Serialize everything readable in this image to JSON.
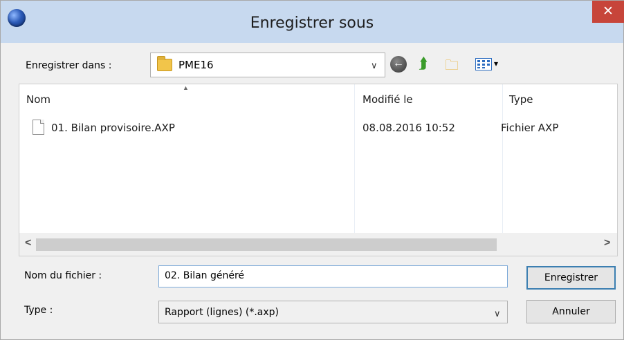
{
  "window": {
    "title": "Enregistrer sous",
    "close_glyph": "✕"
  },
  "toolbar": {
    "save_in_label": "Enregistrer dans :",
    "location": "PME16",
    "icons": [
      "folder-icon",
      "back-icon",
      "up-folder-icon",
      "new-folder-icon",
      "view-menu-icon"
    ]
  },
  "filelist": {
    "columns": [
      "Nom",
      "Modifié le",
      "Type"
    ],
    "rows": [
      {
        "name": "01. Bilan provisoire.AXP",
        "modified": "08.08.2016 10:52",
        "type": "Fichier AXP"
      }
    ]
  },
  "form": {
    "filename_label": "Nom du fichier :",
    "filename_value": "02. Bilan généré",
    "type_label": "Type :",
    "type_value": "Rapport (lignes) (*.axp)"
  },
  "buttons": {
    "save": "Enregistrer",
    "cancel": "Annuler"
  },
  "colors": {
    "titlebar": "#c7d9ef",
    "close": "#c7453a",
    "default_button_border": "#3c7fb1"
  }
}
